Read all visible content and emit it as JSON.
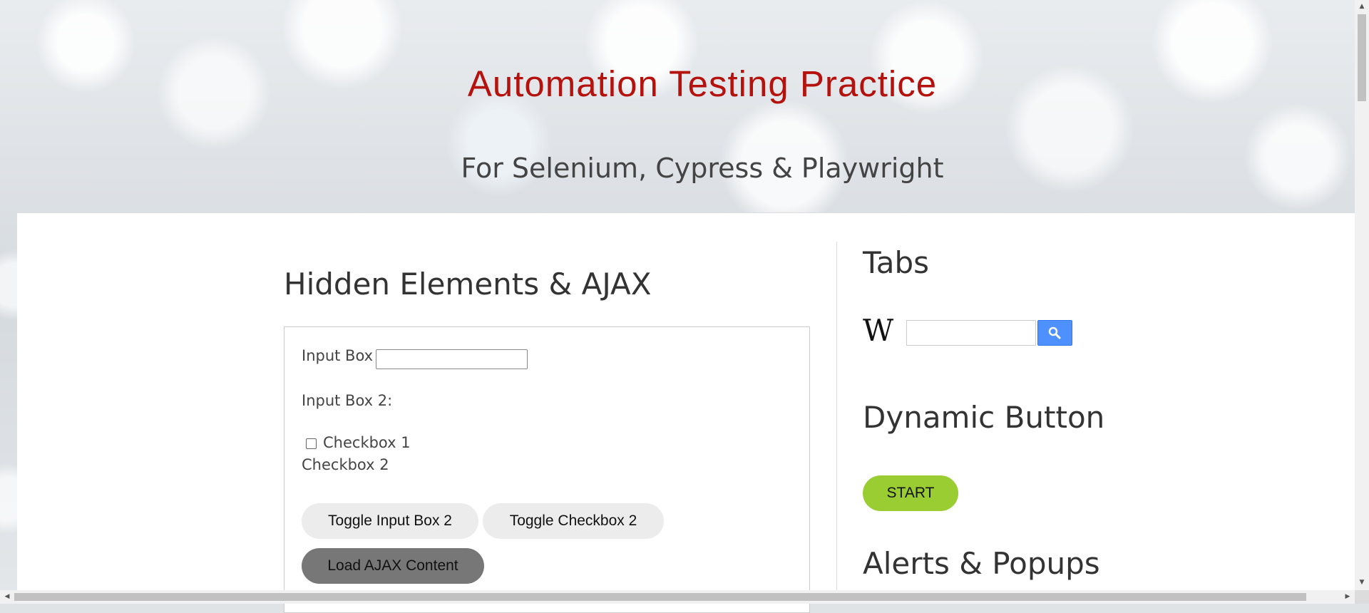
{
  "header": {
    "title": "Automation Testing Practice",
    "subtitle": "For Selenium, Cypress & Playwright",
    "title_color": "#b5120e"
  },
  "hidden_section": {
    "title": "Hidden Elements & AJAX",
    "input_box_1_label": "Input Box 1:",
    "input_box_1_value": "",
    "input_box_2_label": "Input Box 2:",
    "checkbox_1_label": "Checkbox 1",
    "checkbox_1_checked": false,
    "checkbox_2_label": "Checkbox 2",
    "toggle_input_button": "Toggle Input Box 2",
    "toggle_checkbox_button": "Toggle Checkbox 2",
    "load_ajax_button": "Load AJAX Content"
  },
  "tabs_section": {
    "title": "Tabs",
    "wiki_logo": "W",
    "search_value": "",
    "search_icon": "search-icon",
    "search_button_color": "#4d90fe"
  },
  "dynamic_section": {
    "title": "Dynamic Button",
    "start_button": "START",
    "start_button_color": "#9acd32"
  },
  "alerts_section": {
    "title": "Alerts & Popups"
  }
}
